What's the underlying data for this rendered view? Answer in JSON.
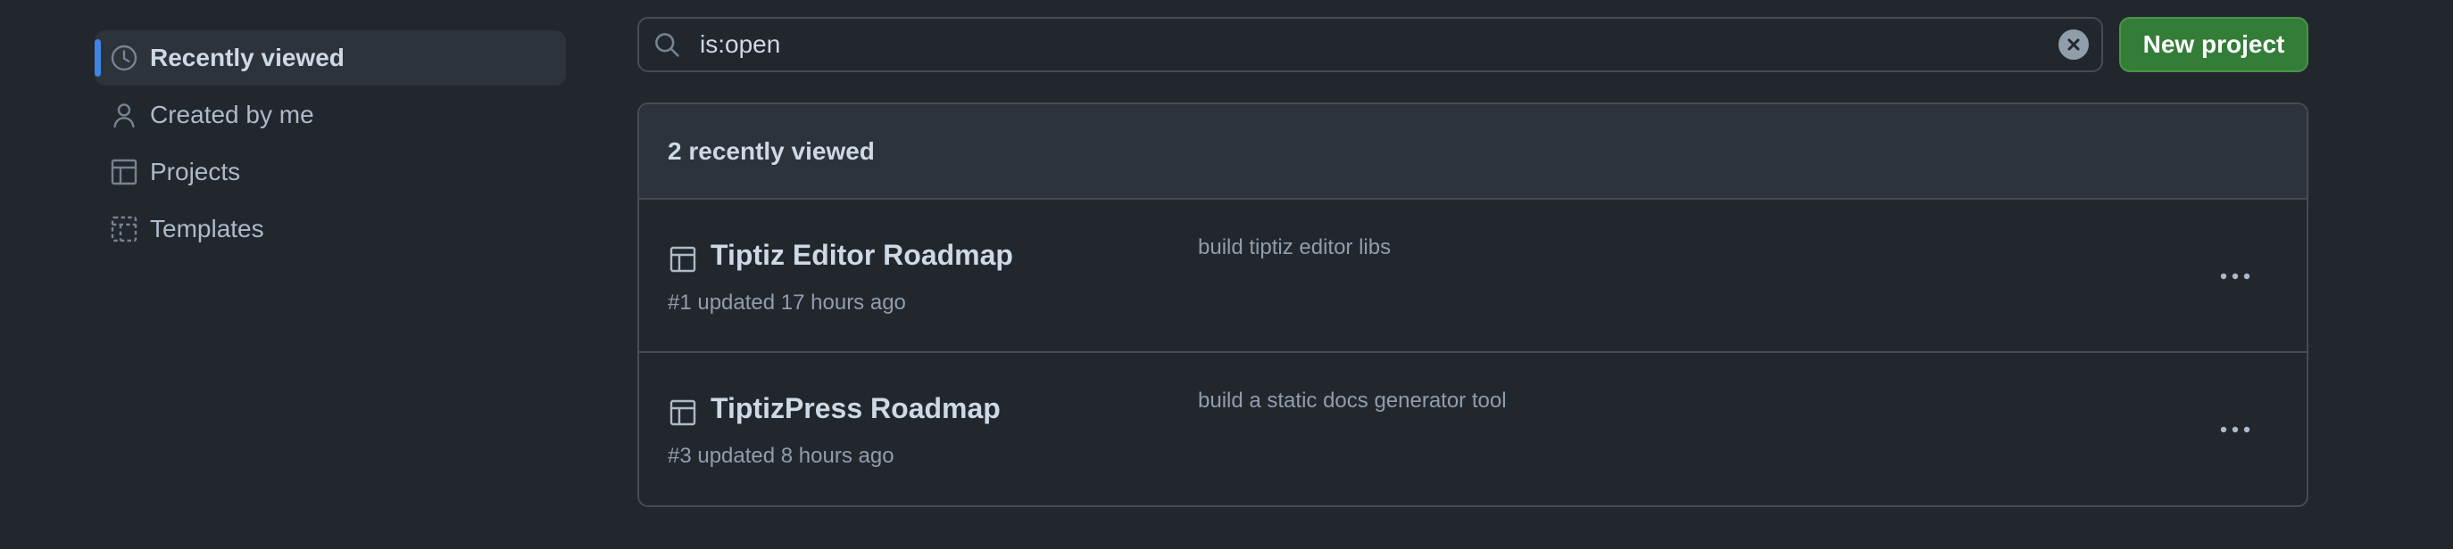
{
  "sidebar": {
    "items": [
      {
        "label": "Recently viewed",
        "icon": "clock-icon",
        "active": true
      },
      {
        "label": "Created by me",
        "icon": "person-icon",
        "active": false
      },
      {
        "label": "Projects",
        "icon": "table-icon",
        "active": false
      },
      {
        "label": "Templates",
        "icon": "project-template-icon",
        "active": false
      }
    ]
  },
  "search": {
    "value": "is:open",
    "icon": "search-icon"
  },
  "toolbar": {
    "new_project_label": "New project"
  },
  "list": {
    "header": "2 recently viewed",
    "projects": [
      {
        "title": "Tiptiz Editor Roadmap",
        "meta": "#1 updated 17 hours ago",
        "description": "build tiptiz editor libs"
      },
      {
        "title": "TiptizPress Roadmap",
        "meta": "#3 updated 8 hours ago",
        "description": "build a static docs generator tool"
      }
    ]
  },
  "colors": {
    "background": "#22272e",
    "accent": "#4184e4",
    "primary_button": "#347d39"
  }
}
